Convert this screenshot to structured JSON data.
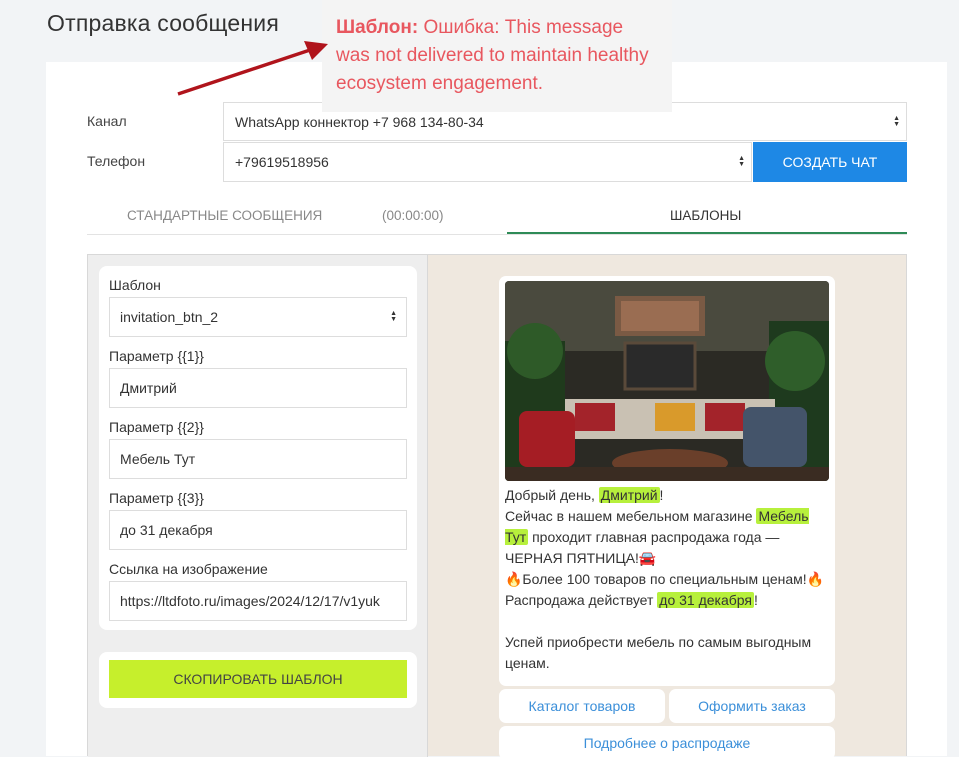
{
  "page": {
    "title": "Отправка сообщения"
  },
  "annotation": {
    "prefix": "Шаблон:",
    "text": "Ошибка: This message was not delivered to maintain healthy ecosystem engagement."
  },
  "channel": {
    "label": "Канал",
    "value": "WhatsApp коннектор +7 968 134-80-34"
  },
  "phone": {
    "label": "Телефон",
    "value": "+79619518956"
  },
  "create_chat_button": "СОЗДАТЬ ЧАТ",
  "tabs": [
    {
      "label": "СТАНДАРТНЫЕ СООБЩЕНИЯ"
    },
    {
      "label": "(00:00:00)"
    },
    {
      "label": "ШАБЛОНЫ",
      "active": true
    }
  ],
  "template_form": {
    "template_label": "Шаблон",
    "template_value": "invitation_btn_2",
    "param1_label": "Параметр {{1}}",
    "param1_value": "Дмитрий",
    "param2_label": "Параметр {{2}}",
    "param2_value": "Мебель Тут",
    "param3_label": "Параметр {{3}}",
    "param3_value": "до 31 декабря",
    "image_link_label": "Ссылка на изображение",
    "image_link_value": "https://ltdfoto.ru/images/2024/12/17/v1yuk"
  },
  "copy_button": "СКОПИРОВАТЬ ШАБЛОН",
  "preview": {
    "line1_a": "Добрый день, ",
    "line1_hl": "Дмитрий",
    "line1_b": "!",
    "line2_a": "Сейчас в нашем мебельном магазине ",
    "line2_hl": "Мебель Тут",
    "line2_b": " проходит главная распродажа года — ЧЕРНАЯ ПЯТНИЦА!🚘",
    "line3": "🔥Более 100 товаров по специальным ценам!🔥",
    "line4_a": "Распродажа действует ",
    "line4_hl": "до 31 декабря",
    "line4_b": "!",
    "line5": "Успей приобрести мебель по самым выгодным ценам.",
    "buttons": [
      "Каталог товаров",
      "Оформить заказ",
      "Подробнее о распродаже"
    ]
  },
  "colors": {
    "primary_button": "#1e88e5",
    "copy_button": "#c6ef2c",
    "highlight": "#b7f03c",
    "annotation_text": "#e8575f",
    "quick_reply_text": "#3b8fd9",
    "tab_underline": "#2e8b57"
  },
  "icons": [
    "select-arrows-icon",
    "annotation-arrow"
  ]
}
